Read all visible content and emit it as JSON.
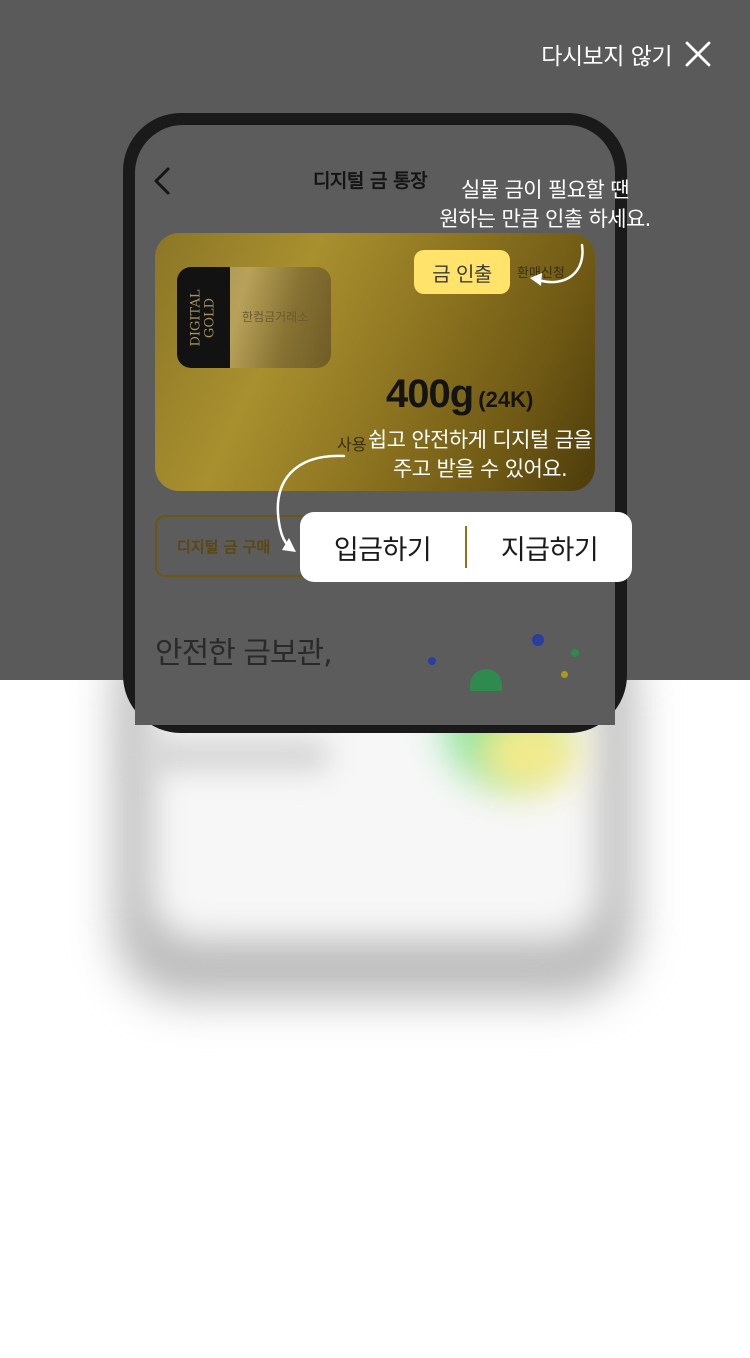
{
  "overlay": {
    "dismiss_label": "다시보지 않기",
    "close_icon": "close-icon"
  },
  "phone": {
    "title": "디지털 금 통장",
    "back_icon": "chevron-left-icon",
    "card": {
      "gold_bar_logo": "DIGITAL GOLD",
      "gold_bar_brand": "한컴금거래소",
      "amount": "400g",
      "unit": "(24K)",
      "usage_label": "사용",
      "withdraw_chip": "금 인출",
      "chip_side_label": "환매신청"
    },
    "buy_button": "디지털 금 구매",
    "section_heading": "안전한 금보관,"
  },
  "callouts": {
    "withdraw_tip": [
      "실물 금이 필요할 땐",
      "원하는 만큼 인출 하세요."
    ],
    "transfer_tip": [
      "쉽고 안전하게 디지털 금을",
      "주고 받을 수 있어요."
    ]
  },
  "actions": {
    "deposit": "입금하기",
    "pay": "지급하기"
  },
  "colors": {
    "overlay": "#5a5a5a",
    "chip": "#ffe36a",
    "divider": "#8a7416"
  }
}
